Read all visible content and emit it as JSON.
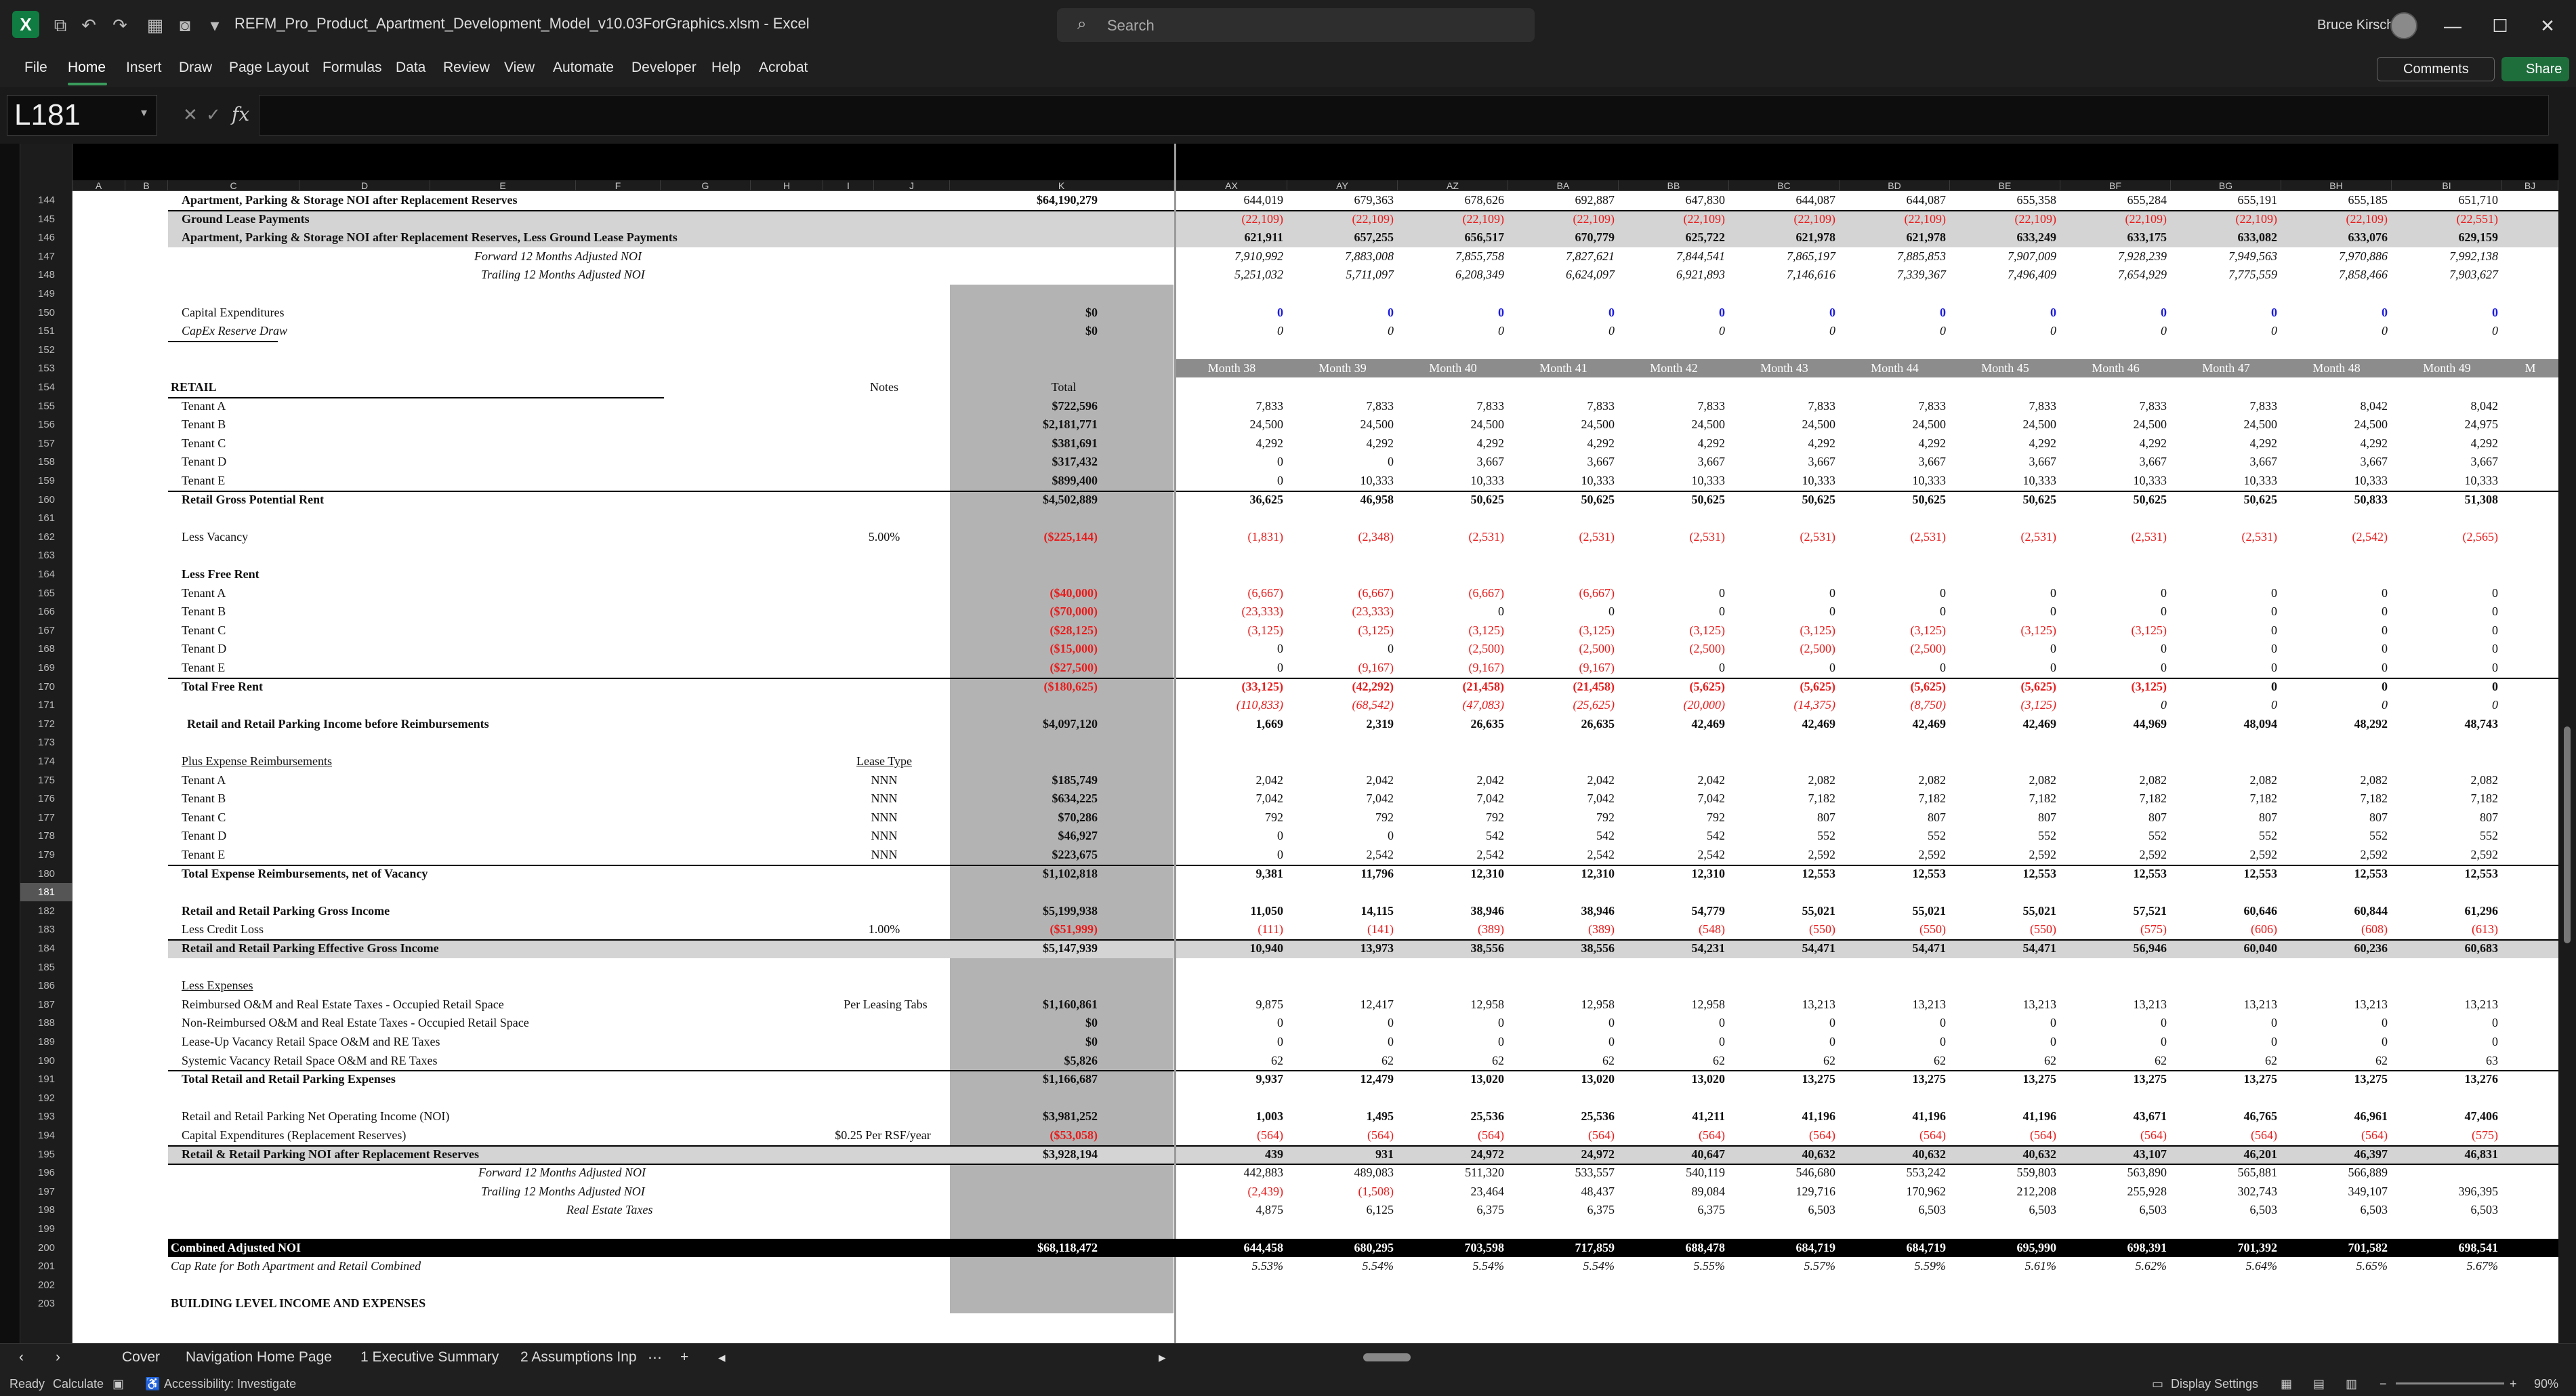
{
  "app": {
    "file_title": "REFM_Pro_Product_Apartment_Development_Model_v10.03ForGraphics.xlsm  -  Excel",
    "search_placeholder": "Search",
    "user_name": "Bruce Kirsch",
    "accent_color": "#107c41"
  },
  "menu": [
    "File",
    "Home",
    "Insert",
    "Draw",
    "Page Layout",
    "Formulas",
    "Data",
    "Review",
    "View",
    "Automate",
    "Developer",
    "Help",
    "Acrobat"
  ],
  "buttons": {
    "comments": "Comments",
    "share": "Share"
  },
  "formula_bar": {
    "name_box": "L181",
    "formula": ""
  },
  "columns": [
    "A",
    "B",
    "C",
    "D",
    "E",
    "F",
    "G",
    "H",
    "I",
    "J",
    "K",
    "AX",
    "AY",
    "AZ",
    "BA",
    "BB",
    "BC",
    "BD",
    "BE",
    "BF",
    "BG",
    "BH",
    "BI",
    "BJ"
  ],
  "rows": [
    "144",
    "145",
    "146",
    "147",
    "148",
    "149",
    "150",
    "151",
    "152",
    "153",
    "154",
    "155",
    "156",
    "157",
    "158",
    "159",
    "160",
    "161",
    "162",
    "163",
    "164",
    "165",
    "166",
    "167",
    "168",
    "169",
    "170",
    "171",
    "172",
    "173",
    "174",
    "175",
    "176",
    "177",
    "178",
    "179",
    "180",
    "181",
    "182",
    "183",
    "184",
    "185",
    "186",
    "187",
    "188",
    "189",
    "190",
    "191",
    "192",
    "193",
    "194",
    "195",
    "196",
    "197",
    "198",
    "199",
    "200",
    "201",
    "202",
    "203"
  ],
  "selected_row": "181",
  "months": [
    "Month 38",
    "Month 39",
    "Month 40",
    "Month 41",
    "Month 42",
    "Month 43",
    "Month 44",
    "Month 45",
    "Month 46",
    "Month 47",
    "Month 48",
    "Month 49",
    "M"
  ],
  "labels": {
    "r144": "Apartment, Parking & Storage NOI after Replacement Reserves",
    "r145": "Ground Lease Payments",
    "r146": "Apartment, Parking & Storage NOI after Replacement Reserves, Less Ground Lease Payments",
    "r147": "Forward 12 Months Adjusted NOI",
    "r148": "Trailing 12 Months Adjusted NOI",
    "r150": "Capital Expenditures",
    "r151": "CapEx Reserve Draw",
    "r154": "RETAIL",
    "r154_notes": "Notes",
    "r154_total": "Total",
    "r155": "Tenant A",
    "r156": "Tenant B",
    "r157": "Tenant C",
    "r158": "Tenant D",
    "r159": "Tenant E",
    "r160": "Retail Gross Potential Rent",
    "r162": "Less Vacancy",
    "r162_note": "5.00%",
    "r164": "Less Free Rent",
    "r165": "Tenant A",
    "r166": "Tenant B",
    "r167": "Tenant C",
    "r168": "Tenant D",
    "r169": "Tenant E",
    "r170": "Total Free Rent",
    "r172": "Retail and Retail Parking Income before Reimbursements",
    "r174": "Plus Expense Reimbursements",
    "r174_note": "Lease Type",
    "r175": "Tenant A",
    "r176": "Tenant B",
    "r177": "Tenant C",
    "r178": "Tenant D",
    "r179": "Tenant E",
    "nnn": "NNN",
    "r180": "Total Expense Reimbursements, net of Vacancy",
    "r182": "Retail and Retail Parking Gross Income",
    "r183": "Less Credit Loss",
    "r183_note": "1.00%",
    "r184": "Retail and Retail Parking Effective Gross Income",
    "r186": "Less Expenses",
    "r187": "Reimbursed O&M and Real Estate Taxes - Occupied Retail Space",
    "r187_note": "Per Leasing Tabs",
    "r188": "Non-Reimbursed O&M and Real Estate Taxes - Occupied Retail Space",
    "r189": "Lease-Up Vacancy Retail Space O&M and RE Taxes",
    "r190": "Systemic Vacancy Retail Space O&M and RE Taxes",
    "r191": "Total Retail and Retail Parking Expenses",
    "r193": "Retail and Retail Parking Net Operating Income (NOI)",
    "r194": "Capital Expenditures (Replacement Reserves)",
    "r194_note": "$0.25 Per RSF/year",
    "r195": "Retail & Retail Parking NOI after Replacement Reserves",
    "r196": "Forward 12 Months Adjusted NOI",
    "r197": "Trailing 12 Months Adjusted NOI",
    "r198": "Real Estate Taxes",
    "r200": "Combined Adjusted NOI",
    "r201": "Cap Rate for Both Apartment and Retail Combined",
    "r203": "BUILDING LEVEL INCOME AND EXPENSES"
  },
  "totals": {
    "r144": "$64,190,279",
    "r150": "$0",
    "r151": "$0",
    "r155": "$722,596",
    "r156": "$2,181,771",
    "r157": "$381,691",
    "r158": "$317,432",
    "r159": "$899,400",
    "r160": "$4,502,889",
    "r162": "($225,144)",
    "r165": "($40,000)",
    "r166": "($70,000)",
    "r167": "($28,125)",
    "r168": "($15,000)",
    "r169": "($27,500)",
    "r170": "($180,625)",
    "r172": "$4,097,120",
    "r175": "$185,749",
    "r176": "$634,225",
    "r177": "$70,286",
    "r178": "$46,927",
    "r179": "$223,675",
    "r180": "$1,102,818",
    "r182": "$5,199,938",
    "r183": "($51,999)",
    "r184": "$5,147,939",
    "r187": "$1,160,861",
    "r188": "$0",
    "r189": "$0",
    "r190": "$5,826",
    "r191": "$1,166,687",
    "r193": "$3,981,252",
    "r194": "($53,058)",
    "r195": "$3,928,194",
    "r200": "$68,118,472"
  },
  "grid": {
    "r144": [
      "644,019",
      "679,363",
      "678,626",
      "692,887",
      "647,830",
      "644,087",
      "644,087",
      "655,358",
      "655,284",
      "655,191",
      "655,185",
      "651,710"
    ],
    "r145": [
      "(22,109)",
      "(22,109)",
      "(22,109)",
      "(22,109)",
      "(22,109)",
      "(22,109)",
      "(22,109)",
      "(22,109)",
      "(22,109)",
      "(22,109)",
      "(22,109)",
      "(22,551)"
    ],
    "r146": [
      "621,911",
      "657,255",
      "656,517",
      "670,779",
      "625,722",
      "621,978",
      "621,978",
      "633,249",
      "633,175",
      "633,082",
      "633,076",
      "629,159"
    ],
    "r147": [
      "7,910,992",
      "7,883,008",
      "7,855,758",
      "7,827,621",
      "7,844,541",
      "7,865,197",
      "7,885,853",
      "7,907,009",
      "7,928,239",
      "7,949,563",
      "7,970,886",
      "7,992,138"
    ],
    "r148": [
      "5,251,032",
      "5,711,097",
      "6,208,349",
      "6,624,097",
      "6,921,893",
      "7,146,616",
      "7,339,367",
      "7,496,409",
      "7,654,929",
      "7,775,559",
      "7,858,466",
      "7,903,627"
    ],
    "r150": [
      "0",
      "0",
      "0",
      "0",
      "0",
      "0",
      "0",
      "0",
      "0",
      "0",
      "0",
      "0"
    ],
    "r151": [
      "0",
      "0",
      "0",
      "0",
      "0",
      "0",
      "0",
      "0",
      "0",
      "0",
      "0",
      "0"
    ],
    "r155": [
      "7,833",
      "7,833",
      "7,833",
      "7,833",
      "7,833",
      "7,833",
      "7,833",
      "7,833",
      "7,833",
      "7,833",
      "8,042",
      "8,042"
    ],
    "r156": [
      "24,500",
      "24,500",
      "24,500",
      "24,500",
      "24,500",
      "24,500",
      "24,500",
      "24,500",
      "24,500",
      "24,500",
      "24,500",
      "24,975"
    ],
    "r157": [
      "4,292",
      "4,292",
      "4,292",
      "4,292",
      "4,292",
      "4,292",
      "4,292",
      "4,292",
      "4,292",
      "4,292",
      "4,292",
      "4,292"
    ],
    "r158": [
      "0",
      "0",
      "3,667",
      "3,667",
      "3,667",
      "3,667",
      "3,667",
      "3,667",
      "3,667",
      "3,667",
      "3,667",
      "3,667"
    ],
    "r159": [
      "0",
      "10,333",
      "10,333",
      "10,333",
      "10,333",
      "10,333",
      "10,333",
      "10,333",
      "10,333",
      "10,333",
      "10,333",
      "10,333"
    ],
    "r160": [
      "36,625",
      "46,958",
      "50,625",
      "50,625",
      "50,625",
      "50,625",
      "50,625",
      "50,625",
      "50,625",
      "50,625",
      "50,833",
      "51,308"
    ],
    "r162": [
      "(1,831)",
      "(2,348)",
      "(2,531)",
      "(2,531)",
      "(2,531)",
      "(2,531)",
      "(2,531)",
      "(2,531)",
      "(2,531)",
      "(2,531)",
      "(2,542)",
      "(2,565)"
    ],
    "r165": [
      "(6,667)",
      "(6,667)",
      "(6,667)",
      "(6,667)",
      "0",
      "0",
      "0",
      "0",
      "0",
      "0",
      "0",
      "0"
    ],
    "r166": [
      "(23,333)",
      "(23,333)",
      "0",
      "0",
      "0",
      "0",
      "0",
      "0",
      "0",
      "0",
      "0",
      "0"
    ],
    "r167": [
      "(3,125)",
      "(3,125)",
      "(3,125)",
      "(3,125)",
      "(3,125)",
      "(3,125)",
      "(3,125)",
      "(3,125)",
      "(3,125)",
      "0",
      "0",
      "0"
    ],
    "r168": [
      "0",
      "0",
      "(2,500)",
      "(2,500)",
      "(2,500)",
      "(2,500)",
      "(2,500)",
      "0",
      "0",
      "0",
      "0",
      "0"
    ],
    "r169": [
      "0",
      "(9,167)",
      "(9,167)",
      "(9,167)",
      "0",
      "0",
      "0",
      "0",
      "0",
      "0",
      "0",
      "0"
    ],
    "r170": [
      "(33,125)",
      "(42,292)",
      "(21,458)",
      "(21,458)",
      "(5,625)",
      "(5,625)",
      "(5,625)",
      "(5,625)",
      "(3,125)",
      "0",
      "0",
      "0"
    ],
    "r171": [
      "(110,833)",
      "(68,542)",
      "(47,083)",
      "(25,625)",
      "(20,000)",
      "(14,375)",
      "(8,750)",
      "(3,125)",
      "0",
      "0",
      "0",
      "0"
    ],
    "r172": [
      "1,669",
      "2,319",
      "26,635",
      "26,635",
      "42,469",
      "42,469",
      "42,469",
      "42,469",
      "44,969",
      "48,094",
      "48,292",
      "48,743"
    ],
    "r175": [
      "2,042",
      "2,042",
      "2,042",
      "2,042",
      "2,042",
      "2,082",
      "2,082",
      "2,082",
      "2,082",
      "2,082",
      "2,082",
      "2,082"
    ],
    "r176": [
      "7,042",
      "7,042",
      "7,042",
      "7,042",
      "7,042",
      "7,182",
      "7,182",
      "7,182",
      "7,182",
      "7,182",
      "7,182",
      "7,182"
    ],
    "r177": [
      "792",
      "792",
      "792",
      "792",
      "792",
      "807",
      "807",
      "807",
      "807",
      "807",
      "807",
      "807"
    ],
    "r178": [
      "0",
      "0",
      "542",
      "542",
      "542",
      "552",
      "552",
      "552",
      "552",
      "552",
      "552",
      "552"
    ],
    "r179": [
      "0",
      "2,542",
      "2,542",
      "2,542",
      "2,542",
      "2,592",
      "2,592",
      "2,592",
      "2,592",
      "2,592",
      "2,592",
      "2,592"
    ],
    "r180": [
      "9,381",
      "11,796",
      "12,310",
      "12,310",
      "12,310",
      "12,553",
      "12,553",
      "12,553",
      "12,553",
      "12,553",
      "12,553",
      "12,553"
    ],
    "r182": [
      "11,050",
      "14,115",
      "38,946",
      "38,946",
      "54,779",
      "55,021",
      "55,021",
      "55,021",
      "57,521",
      "60,646",
      "60,844",
      "61,296"
    ],
    "r183": [
      "(111)",
      "(141)",
      "(389)",
      "(389)",
      "(548)",
      "(550)",
      "(550)",
      "(550)",
      "(575)",
      "(606)",
      "(608)",
      "(613)"
    ],
    "r184": [
      "10,940",
      "13,973",
      "38,556",
      "38,556",
      "54,231",
      "54,471",
      "54,471",
      "54,471",
      "56,946",
      "60,040",
      "60,236",
      "60,683"
    ],
    "r187": [
      "9,875",
      "12,417",
      "12,958",
      "12,958",
      "12,958",
      "13,213",
      "13,213",
      "13,213",
      "13,213",
      "13,213",
      "13,213",
      "13,213"
    ],
    "r188": [
      "0",
      "0",
      "0",
      "0",
      "0",
      "0",
      "0",
      "0",
      "0",
      "0",
      "0",
      "0"
    ],
    "r189": [
      "0",
      "0",
      "0",
      "0",
      "0",
      "0",
      "0",
      "0",
      "0",
      "0",
      "0",
      "0"
    ],
    "r190": [
      "62",
      "62",
      "62",
      "62",
      "62",
      "62",
      "62",
      "62",
      "62",
      "62",
      "62",
      "63"
    ],
    "r191": [
      "9,937",
      "12,479",
      "13,020",
      "13,020",
      "13,020",
      "13,275",
      "13,275",
      "13,275",
      "13,275",
      "13,275",
      "13,275",
      "13,276"
    ],
    "r193": [
      "1,003",
      "1,495",
      "25,536",
      "25,536",
      "41,211",
      "41,196",
      "41,196",
      "41,196",
      "43,671",
      "46,765",
      "46,961",
      "47,406"
    ],
    "r194": [
      "(564)",
      "(564)",
      "(564)",
      "(564)",
      "(564)",
      "(564)",
      "(564)",
      "(564)",
      "(564)",
      "(564)",
      "(564)",
      "(575)"
    ],
    "r195": [
      "439",
      "931",
      "24,972",
      "24,972",
      "40,647",
      "40,632",
      "40,632",
      "40,632",
      "43,107",
      "46,201",
      "46,397",
      "46,831"
    ],
    "r196": [
      "442,883",
      "489,083",
      "511,320",
      "533,557",
      "540,119",
      "546,680",
      "553,242",
      "559,803",
      "563,890",
      "565,881",
      "566,889"
    ],
    "r197": [
      "(2,439)",
      "(1,508)",
      "23,464",
      "48,437",
      "89,084",
      "129,716",
      "170,962",
      "212,208",
      "255,928",
      "302,743",
      "349,107",
      "396,395"
    ],
    "r198": [
      "4,875",
      "6,125",
      "6,375",
      "6,375",
      "6,375",
      "6,503",
      "6,503",
      "6,503",
      "6,503",
      "6,503",
      "6,503",
      "6,503"
    ],
    "r200": [
      "644,458",
      "680,295",
      "703,598",
      "717,859",
      "688,478",
      "684,719",
      "684,719",
      "695,990",
      "698,391",
      "701,392",
      "701,582",
      "698,541"
    ],
    "r201": [
      "5.53%",
      "5.54%",
      "5.54%",
      "5.54%",
      "5.55%",
      "5.57%",
      "5.59%",
      "5.61%",
      "5.62%",
      "5.64%",
      "5.65%",
      "5.67%"
    ]
  },
  "sheets": [
    "Cover",
    "Navigation Home Page",
    "1 Executive Summary",
    "2 Assumptions Inp"
  ],
  "status": {
    "ready": "Ready",
    "calculate": "Calculate",
    "accessibility": "Accessibility: Investigate",
    "display_settings": "Display Settings",
    "zoom": "90%"
  }
}
